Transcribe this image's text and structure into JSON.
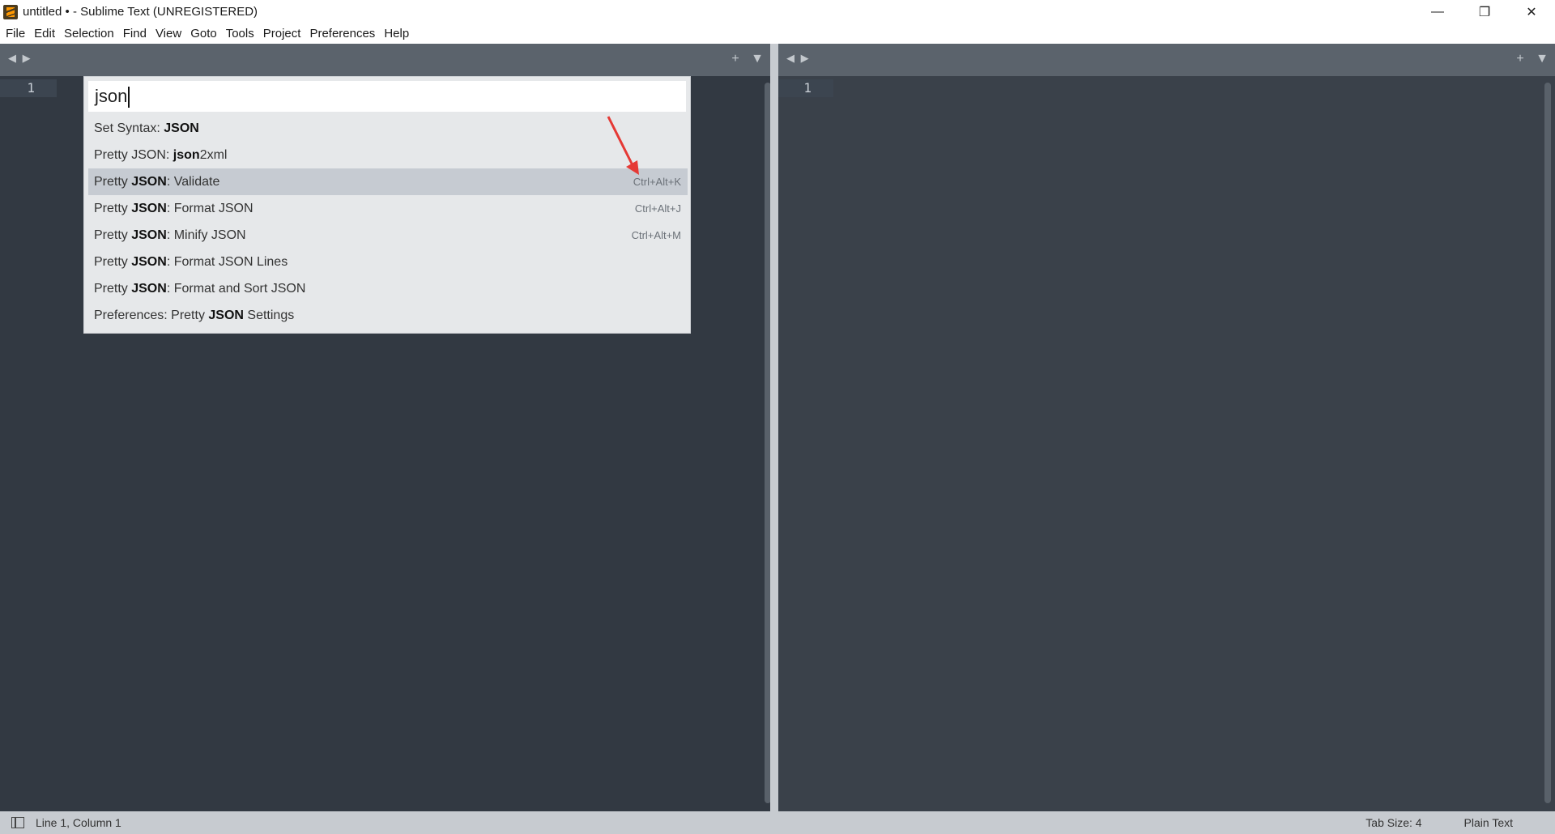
{
  "window": {
    "title": "untitled • - Sublime Text (UNREGISTERED)",
    "controls": [
      "—",
      "❐",
      "✕"
    ]
  },
  "menu": [
    "File",
    "Edit",
    "Selection",
    "Find",
    "View",
    "Goto",
    "Tools",
    "Project",
    "Preferences",
    "Help"
  ],
  "tabstrip": {
    "nav": "◀ ▶",
    "add": "+",
    "dropdown": "▼"
  },
  "editor": {
    "left_line": "1",
    "right_line": "1"
  },
  "palette": {
    "query": "json",
    "items": [
      {
        "prefix": "Set Syntax: ",
        "bold": "JSON",
        "suffix": "",
        "shortcut": ""
      },
      {
        "prefix": "Pretty JSON: ",
        "bold": "json",
        "suffix": "2xml",
        "shortcut": ""
      },
      {
        "prefix": "Pretty ",
        "bold": "JSON",
        "suffix": ": Validate",
        "shortcut": "Ctrl+Alt+K"
      },
      {
        "prefix": "Pretty ",
        "bold": "JSON",
        "suffix": ": Format JSON",
        "shortcut": "Ctrl+Alt+J"
      },
      {
        "prefix": "Pretty ",
        "bold": "JSON",
        "suffix": ": Minify JSON",
        "shortcut": "Ctrl+Alt+M"
      },
      {
        "prefix": "Pretty ",
        "bold": "JSON",
        "suffix": ": Format JSON Lines",
        "shortcut": ""
      },
      {
        "prefix": "Pretty ",
        "bold": "JSON",
        "suffix": ": Format and Sort JSON",
        "shortcut": ""
      },
      {
        "prefix": "Preferences: Pretty ",
        "bold": "JSON",
        "suffix": " Settings",
        "shortcut": ""
      }
    ],
    "selected_index": 2
  },
  "status": {
    "position": "Line 1, Column 1",
    "tab_size": "Tab Size: 4",
    "syntax": "Plain Text"
  },
  "colors": {
    "editor_bg": "#323942",
    "tabstrip_bg": "#5b636c",
    "palette_bg": "#e6e8ea",
    "selected_bg": "#c6cbd2",
    "annotation": "#e53935"
  }
}
